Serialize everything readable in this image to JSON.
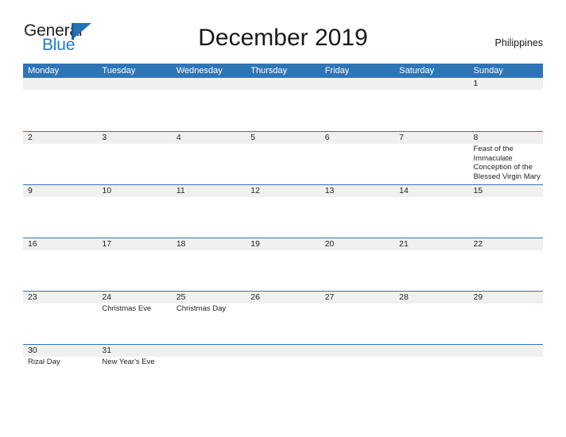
{
  "brand": {
    "name_part1": "General",
    "name_part2": "Blue",
    "flag_icon": "flag-icon"
  },
  "header": {
    "title": "December 2019",
    "region": "Philippines"
  },
  "calendar": {
    "weekdays": [
      "Monday",
      "Tuesday",
      "Wednesday",
      "Thursday",
      "Friday",
      "Saturday",
      "Sunday"
    ],
    "accent_color": "#2e75b6",
    "band_color": "#f0f0f0",
    "weeks": [
      {
        "days": [
          {
            "number": "",
            "events": []
          },
          {
            "number": "",
            "events": []
          },
          {
            "number": "",
            "events": []
          },
          {
            "number": "",
            "events": []
          },
          {
            "number": "",
            "events": []
          },
          {
            "number": "",
            "events": []
          },
          {
            "number": "1",
            "events": []
          }
        ]
      },
      {
        "days": [
          {
            "number": "2",
            "events": []
          },
          {
            "number": "3",
            "events": []
          },
          {
            "number": "4",
            "events": []
          },
          {
            "number": "5",
            "events": []
          },
          {
            "number": "6",
            "events": []
          },
          {
            "number": "7",
            "events": []
          },
          {
            "number": "8",
            "events": [
              "Feast of the Immaculate Conception of the Blessed Virgin Mary"
            ]
          }
        ]
      },
      {
        "days": [
          {
            "number": "9",
            "events": []
          },
          {
            "number": "10",
            "events": []
          },
          {
            "number": "11",
            "events": []
          },
          {
            "number": "12",
            "events": []
          },
          {
            "number": "13",
            "events": []
          },
          {
            "number": "14",
            "events": []
          },
          {
            "number": "15",
            "events": []
          }
        ]
      },
      {
        "days": [
          {
            "number": "16",
            "events": []
          },
          {
            "number": "17",
            "events": []
          },
          {
            "number": "18",
            "events": []
          },
          {
            "number": "19",
            "events": []
          },
          {
            "number": "20",
            "events": []
          },
          {
            "number": "21",
            "events": []
          },
          {
            "number": "22",
            "events": []
          }
        ]
      },
      {
        "days": [
          {
            "number": "23",
            "events": []
          },
          {
            "number": "24",
            "events": [
              "Christmas Eve"
            ]
          },
          {
            "number": "25",
            "events": [
              "Christmas Day"
            ]
          },
          {
            "number": "26",
            "events": []
          },
          {
            "number": "27",
            "events": []
          },
          {
            "number": "28",
            "events": []
          },
          {
            "number": "29",
            "events": []
          }
        ]
      },
      {
        "days": [
          {
            "number": "30",
            "events": [
              "Rizal Day"
            ]
          },
          {
            "number": "31",
            "events": [
              "New Year's Eve"
            ]
          },
          {
            "number": "",
            "events": []
          },
          {
            "number": "",
            "events": []
          },
          {
            "number": "",
            "events": []
          },
          {
            "number": "",
            "events": []
          },
          {
            "number": "",
            "events": []
          }
        ]
      }
    ]
  }
}
